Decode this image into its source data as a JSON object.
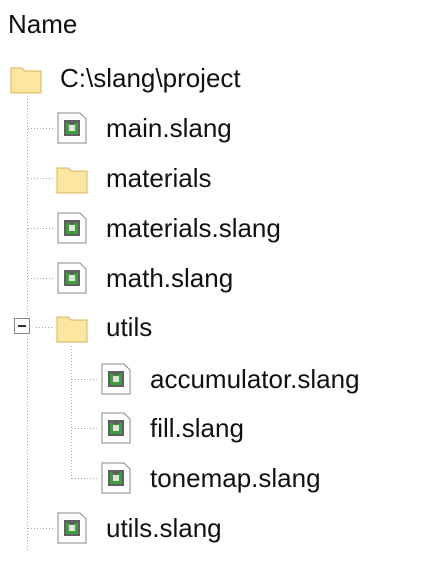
{
  "header": {
    "column_label": "Name"
  },
  "tree": {
    "root": {
      "label": "C:\\slang\\project",
      "icon": "folder-icon"
    },
    "items": [
      {
        "label": "main.slang",
        "icon": "slang-file-icon"
      },
      {
        "label": "materials",
        "icon": "folder-icon"
      },
      {
        "label": "materials.slang",
        "icon": "slang-file-icon"
      },
      {
        "label": "math.slang",
        "icon": "slang-file-icon"
      },
      {
        "label": "utils",
        "icon": "folder-icon",
        "expanded": true,
        "children": [
          {
            "label": "accumulator.slang",
            "icon": "slang-file-icon"
          },
          {
            "label": "fill.slang",
            "icon": "slang-file-icon"
          },
          {
            "label": "tonemap.slang",
            "icon": "slang-file-icon"
          }
        ]
      },
      {
        "label": "utils.slang",
        "icon": "slang-file-icon"
      }
    ]
  },
  "colors": {
    "folder_fill": "#FCE6A0",
    "folder_edge": "#D8B35A",
    "guide_line": "#A9A9A9",
    "text": "#111111"
  }
}
